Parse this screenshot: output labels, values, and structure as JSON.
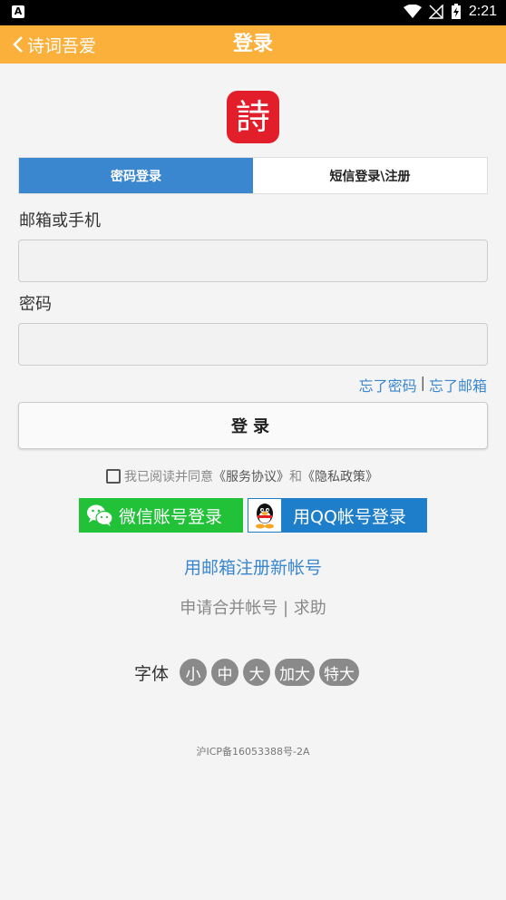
{
  "status_bar": {
    "left_icon_letter": "A",
    "time": "2:21"
  },
  "app_bar": {
    "back_label": "诗词吾爱",
    "title": "登录"
  },
  "logo": {
    "glyph": "詩",
    "color": "#e31e2b"
  },
  "tabs": [
    {
      "label": "密码登录",
      "active": true
    },
    {
      "label": "短信登录\\注册",
      "active": false
    }
  ],
  "form": {
    "account_label": "邮箱或手机",
    "account_value": "",
    "password_label": "密码",
    "password_value": ""
  },
  "forgot": {
    "password": "忘了密码",
    "separator": "|",
    "email": "忘了邮箱"
  },
  "login_button": "登录",
  "agreement": {
    "prefix": "我已阅读并同意",
    "terms": "《服务协议》",
    "and": "和",
    "privacy": "《隐私政策》",
    "checked": false
  },
  "social": {
    "wechat": "微信账号登录",
    "qq": "用QQ帐号登录"
  },
  "register_link": "用邮箱注册新帐号",
  "merge_help": "申请合并帐号 | 求助",
  "font_size": {
    "label": "字体",
    "options": [
      "小",
      "中",
      "大",
      "加大",
      "特大"
    ]
  },
  "icp": "沪ICP备16053388号-2A",
  "colors": {
    "accent": "#fbb03b",
    "tab_active": "#3a87cf",
    "wechat": "#21c138",
    "qq": "#1f7ec9",
    "link": "#3a87cf"
  }
}
